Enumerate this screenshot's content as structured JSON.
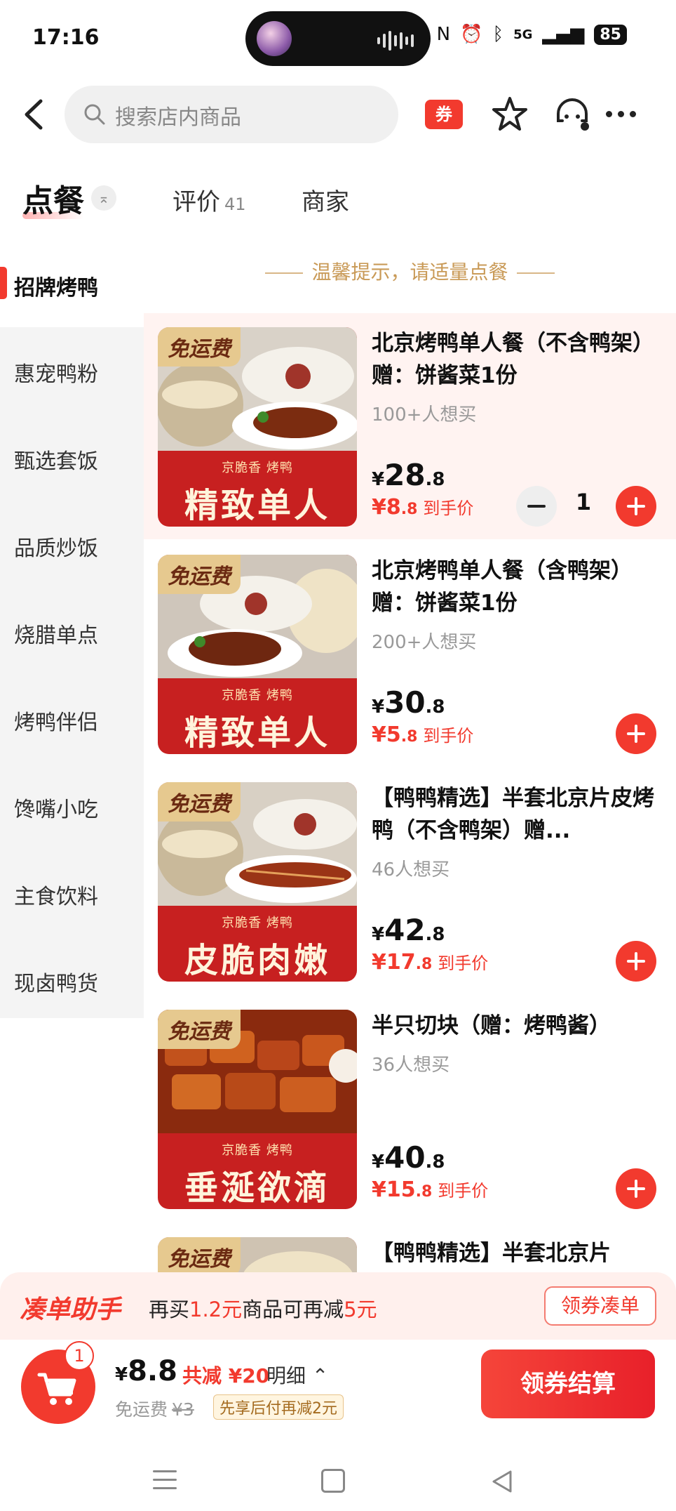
{
  "status": {
    "time": "17:16",
    "network": "5G",
    "battery": "85"
  },
  "search": {
    "placeholder": "搜索店内商品"
  },
  "nav": {
    "coupon": "券"
  },
  "tabs": {
    "order": "点餐",
    "review": "评价",
    "review_count": "41",
    "merchant": "商家"
  },
  "sidebar": {
    "items": [
      {
        "label": "招牌烤鸭",
        "active": true
      },
      {
        "label": "惠宠鸭粉"
      },
      {
        "label": "甄选套饭"
      },
      {
        "label": "品质炒饭"
      },
      {
        "label": "烧腊单点"
      },
      {
        "label": "烤鸭伴侣"
      },
      {
        "label": "馋嘴小吃"
      },
      {
        "label": "主食饮料"
      },
      {
        "label": "现卤鸭货"
      }
    ]
  },
  "tip": "温馨提示，请适量点餐",
  "products": [
    {
      "badge": "免运费",
      "brand": "京脆香 烤鸭",
      "slogan": "精致单人",
      "title": "北京烤鸭单人餐（不含鸭架）赠：饼酱菜1份",
      "want": "100+人想买",
      "price_cur": "¥",
      "price_int": "28",
      "price_dec": ".8",
      "net_val": "¥8",
      "net_dec": ".8",
      "net_label": "到手价",
      "qty": "1"
    },
    {
      "badge": "免运费",
      "brand": "京脆香 烤鸭",
      "slogan": "精致单人",
      "title": "北京烤鸭单人餐（含鸭架）赠：饼酱菜1份",
      "want": "200+人想买",
      "price_cur": "¥",
      "price_int": "30",
      "price_dec": ".8",
      "net_val": "¥5",
      "net_dec": ".8",
      "net_label": "到手价"
    },
    {
      "badge": "免运费",
      "brand": "京脆香 烤鸭",
      "slogan": "皮脆肉嫩",
      "title": "【鸭鸭精选】半套北京片皮烤鸭（不含鸭架）赠...",
      "want": "46人想买",
      "price_cur": "¥",
      "price_int": "42",
      "price_dec": ".8",
      "net_val": "¥17",
      "net_dec": ".8",
      "net_label": "到手价"
    },
    {
      "badge": "免运费",
      "brand": "京脆香 烤鸭",
      "slogan": "垂涎欲滴",
      "title": "半只切块（赠：烤鸭酱）",
      "want": "36人想买",
      "price_cur": "¥",
      "price_int": "40",
      "price_dec": ".8",
      "net_val": "¥15",
      "net_dec": ".8",
      "net_label": "到手价"
    },
    {
      "badge": "免运费",
      "title": "【鸭鸭精选】半套北京片"
    }
  ],
  "assistant": {
    "title": "凑单助手",
    "msg_a": "再买",
    "msg_amount": "1.2元",
    "msg_b": "商品可再减",
    "msg_save": "5元",
    "button": "领券凑单"
  },
  "cart": {
    "count": "1",
    "cur": "¥",
    "total": "8.8",
    "saved": "共减 ¥20",
    "detail": "明细 ⌃",
    "free_ship": "免运费",
    "ship_fee": "¥3",
    "pay_later": "先享后付再减2元",
    "checkout": "领券结算"
  },
  "colors": {
    "accent": "#f23a2e",
    "tip": "#c99a57"
  }
}
